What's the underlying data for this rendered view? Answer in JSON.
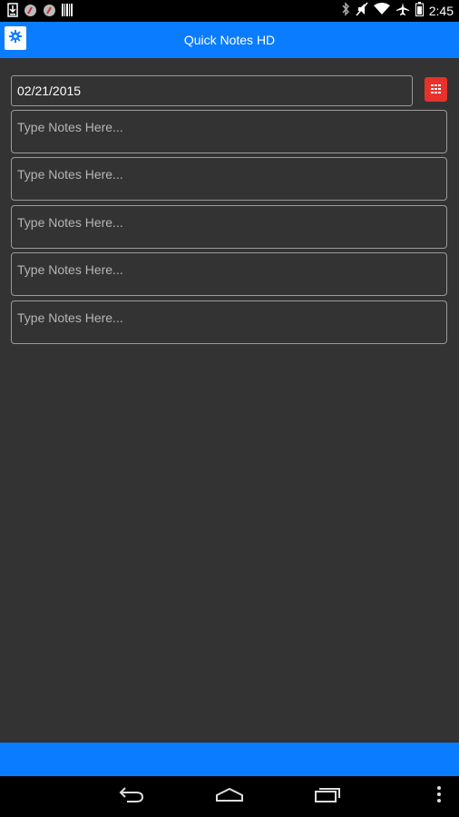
{
  "status_bar": {
    "time": "2:45",
    "left_icons": [
      "download-icon",
      "app-icon-1",
      "app-icon-2",
      "barcode-icon"
    ],
    "right_icons": [
      "bluetooth-icon",
      "mute-icon",
      "wifi-icon",
      "airplane-icon",
      "battery-icon"
    ]
  },
  "app_bar": {
    "title": "Quick Notes HD",
    "color": "#0a7cff"
  },
  "date_field": {
    "value": "02/21/2015"
  },
  "calendar_button": {
    "color": "#e8312b",
    "icon": "calendar-grid-icon"
  },
  "notes": [
    {
      "placeholder": "Type Notes Here..."
    },
    {
      "placeholder": "Type Notes Here..."
    },
    {
      "placeholder": "Type Notes Here..."
    },
    {
      "placeholder": "Type Notes Here..."
    },
    {
      "placeholder": "Type Notes Here..."
    }
  ],
  "nav_bar": {
    "buttons": [
      "back-icon",
      "home-icon",
      "recents-icon",
      "overflow-menu-icon"
    ]
  }
}
